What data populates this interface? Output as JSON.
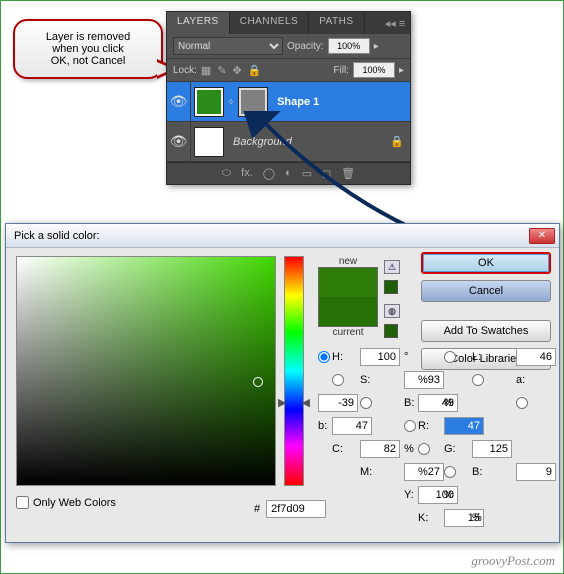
{
  "callout": {
    "line1": "Layer is removed",
    "line2": "when you click",
    "line3": "OK, not Cancel"
  },
  "layers_panel": {
    "tabs": {
      "layers": "LAYERS",
      "channels": "CHANNELS",
      "paths": "PATHS"
    },
    "blend_mode": "Normal",
    "opacity_label": "Opacity:",
    "opacity_value": "100%",
    "lock_label": "Lock:",
    "fill_label": "Fill:",
    "fill_value": "100%",
    "layer1_name": "Shape 1",
    "layer2_name": "Background"
  },
  "dialog": {
    "title": "Pick a solid color:",
    "buttons": {
      "ok": "OK",
      "cancel": "Cancel",
      "swatches": "Add To Swatches",
      "libraries": "Color Libraries"
    },
    "swatch": {
      "new_label": "new",
      "current_label": "current"
    },
    "fields": {
      "H": {
        "label": "H:",
        "value": "100",
        "unit": "°"
      },
      "S": {
        "label": "S:",
        "value": "93",
        "unit": "%"
      },
      "Bv": {
        "label": "B:",
        "value": "49",
        "unit": "%"
      },
      "R": {
        "label": "R:",
        "value": "47",
        "unit": ""
      },
      "G": {
        "label": "G:",
        "value": "125",
        "unit": ""
      },
      "Bb": {
        "label": "B:",
        "value": "9",
        "unit": ""
      },
      "L": {
        "label": "L:",
        "value": "46",
        "unit": ""
      },
      "a": {
        "label": "a:",
        "value": "-39",
        "unit": ""
      },
      "b": {
        "label": "b:",
        "value": "47",
        "unit": ""
      },
      "C": {
        "label": "C:",
        "value": "82",
        "unit": "%"
      },
      "M": {
        "label": "M:",
        "value": "27",
        "unit": "%"
      },
      "Y": {
        "label": "Y:",
        "value": "100",
        "unit": "%"
      },
      "K": {
        "label": "K:",
        "value": "15",
        "unit": "%"
      }
    },
    "hex_label": "#",
    "hex_value": "2f7d09",
    "web_colors": "Only Web Colors"
  },
  "watermark": "groovyPost.com"
}
